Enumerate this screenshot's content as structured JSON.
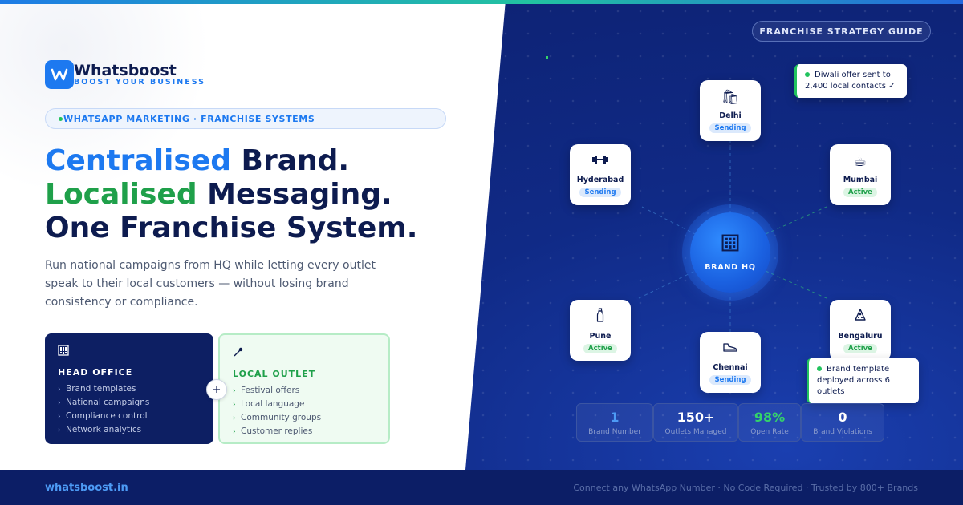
{
  "brand": {
    "name": "Whatsboost",
    "tagline": "BOOST YOUR BUSINESS"
  },
  "pill": {
    "text": "WHATSAPP MARKETING · FRANCHISE SYSTEMS"
  },
  "headline": {
    "line1_accent": "Centralised",
    "line1_rest": " Brand.",
    "line2_accent": "Localised",
    "line2_rest": " Messaging.",
    "line3": "One Franchise System."
  },
  "description": "Run national campaigns from HQ while letting every outlet speak to their local customers — without losing brand consistency or compliance.",
  "head_office": {
    "icon": "building-icon",
    "title": "HEAD OFFICE",
    "items": [
      "Brand templates",
      "National campaigns",
      "Compliance control",
      "Network analytics"
    ]
  },
  "local_outlet": {
    "icon": "pin-icon",
    "title": "LOCAL OUTLET",
    "items": [
      "Festival offers",
      "Local language",
      "Community groups",
      "Customer replies"
    ]
  },
  "plus_label": "+",
  "guide_label": "FRANCHISE STRATEGY GUIDE",
  "hub": {
    "icon": "building-icon",
    "label": "BRAND HQ"
  },
  "nodes": [
    {
      "city": "Delhi",
      "status": "Sending",
      "icon": "shopping-bag-icon"
    },
    {
      "city": "Mumbai",
      "status": "Active",
      "icon": "coffee-icon"
    },
    {
      "city": "Bengaluru",
      "status": "Active",
      "icon": "pizza-icon"
    },
    {
      "city": "Chennai",
      "status": "Sending",
      "icon": "shoe-icon"
    },
    {
      "city": "Pune",
      "status": "Active",
      "icon": "bottle-icon"
    },
    {
      "city": "Hyderabad",
      "status": "Sending",
      "icon": "dumbbell-icon"
    }
  ],
  "toasts": {
    "diwali": "Diwali offer sent to 2,400 local contacts ✓",
    "template": "Brand template deployed across 6 outlets"
  },
  "stats": [
    {
      "value": "1",
      "label": "Brand Number"
    },
    {
      "value": "150+",
      "label": "Outlets Managed"
    },
    {
      "value": "98%",
      "label": "Open Rate"
    },
    {
      "value": "0",
      "label": "Brand Violations"
    }
  ],
  "footer": {
    "url": "whatsboost.in",
    "tagline": "Connect any WhatsApp Number · No Code Required · Trusted by 800+ Brands"
  },
  "colors": {
    "primary_blue": "#1d79f0",
    "accent_green": "#1fa04a",
    "navy": "#0d1b4f",
    "panel_dark": "#0c1e6a"
  }
}
